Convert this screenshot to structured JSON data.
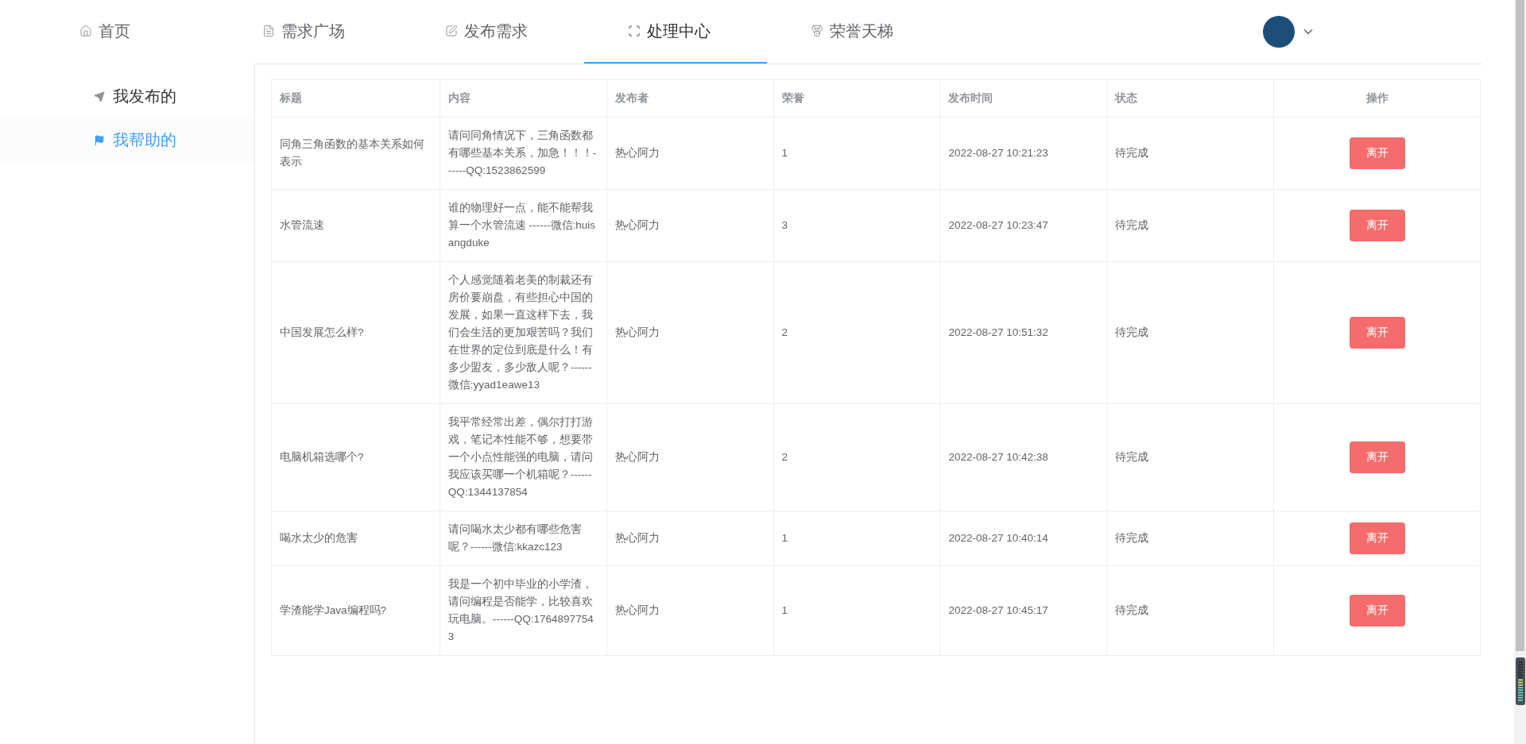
{
  "nav": {
    "tabs": [
      {
        "label": "首页",
        "selected": false
      },
      {
        "label": "需求广场",
        "selected": false
      },
      {
        "label": "发布需求",
        "selected": false
      },
      {
        "label": "处理中心",
        "selected": true
      },
      {
        "label": "荣誉天梯",
        "selected": false
      }
    ]
  },
  "sidebar": {
    "items": [
      {
        "label": "我发布的",
        "selected": false
      },
      {
        "label": "我帮助的",
        "selected": true
      }
    ]
  },
  "table": {
    "columns": [
      "标题",
      "内容",
      "发布者",
      "荣誉",
      "发布时间",
      "状态",
      "操作"
    ],
    "rows": [
      {
        "title": "同角三角函数的基本关系如何表示",
        "content": "请问同角情况下，三角函数都有哪些基本关系，加急！！！------QQ:1523862599",
        "publisher": "热心阿力",
        "honor": "1",
        "time": "2022-08-27 10:21:23",
        "status": "待完成",
        "action": "离开"
      },
      {
        "title": "水管流速",
        "content": "谁的物理好一点，能不能帮我算一个水管流速 ------微信:huisangduke",
        "publisher": "热心阿力",
        "honor": "3",
        "time": "2022-08-27 10:23:47",
        "status": "待完成",
        "action": "离开"
      },
      {
        "title": "中国发展怎么样?",
        "content": "个人感觉随着老美的制裁还有房价要崩盘，有些担心中国的发展，如果一直这样下去，我们会生活的更加艰苦吗？我们在世界的定位到底是什么！有多少盟友，多少敌人呢？------微信:yyad1eawe13",
        "publisher": "热心阿力",
        "honor": "2",
        "time": "2022-08-27 10:51:32",
        "status": "待完成",
        "action": "离开"
      },
      {
        "title": "电脑机箱选哪个?",
        "content": "我平常经常出差，偶尔打打游戏，笔记本性能不够，想要带一个小点性能强的电脑，请问我应该买哪一个机箱呢？------QQ:1344137854",
        "publisher": "热心阿力",
        "honor": "2",
        "time": "2022-08-27 10:42:38",
        "status": "待完成",
        "action": "离开"
      },
      {
        "title": "喝水太少的危害",
        "content": "请问喝水太少都有哪些危害呢？------微信:kkazc123",
        "publisher": "热心阿力",
        "honor": "1",
        "time": "2022-08-27 10:40:14",
        "status": "待完成",
        "action": "离开"
      },
      {
        "title": "学渣能学Java编程吗?",
        "content": "我是一个初中毕业的小学渣，请问编程是否能学，比较喜欢玩电脑。------QQ:17648977543",
        "publisher": "热心阿力",
        "honor": "1",
        "time": "2022-08-27 10:45:17",
        "status": "待完成",
        "action": "离开"
      }
    ]
  }
}
